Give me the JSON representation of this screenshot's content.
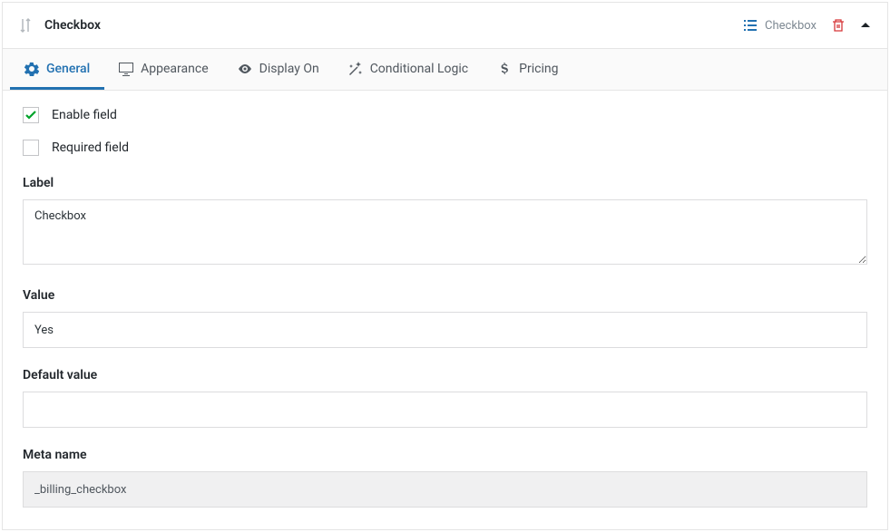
{
  "header": {
    "title": "Checkbox",
    "type_label": "Checkbox"
  },
  "tabs": [
    {
      "label": "General"
    },
    {
      "label": "Appearance"
    },
    {
      "label": "Display On"
    },
    {
      "label": "Conditional Logic"
    },
    {
      "label": "Pricing"
    }
  ],
  "options": {
    "enable_label": "Enable field",
    "required_label": "Required field"
  },
  "fields": {
    "label_label": "Label",
    "label_value": "Checkbox",
    "value_label": "Value",
    "value_value": "Yes",
    "default_label": "Default value",
    "default_value": "",
    "meta_label": "Meta name",
    "meta_value": "_billing_checkbox"
  }
}
